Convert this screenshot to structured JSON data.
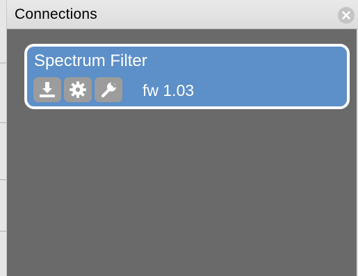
{
  "window": {
    "title": "Connections"
  },
  "connections": [
    {
      "name": "Spectrum Filter",
      "firmware": "fw 1.03",
      "icons": [
        "download-icon",
        "gear-icon",
        "wrench-icon"
      ],
      "selected": true
    }
  ],
  "colors": {
    "panel_bg": "#6a6a6a",
    "card_bg": "#5d8fc8",
    "card_border": "#ffffff",
    "icon_bg": "#9c9c9c"
  }
}
